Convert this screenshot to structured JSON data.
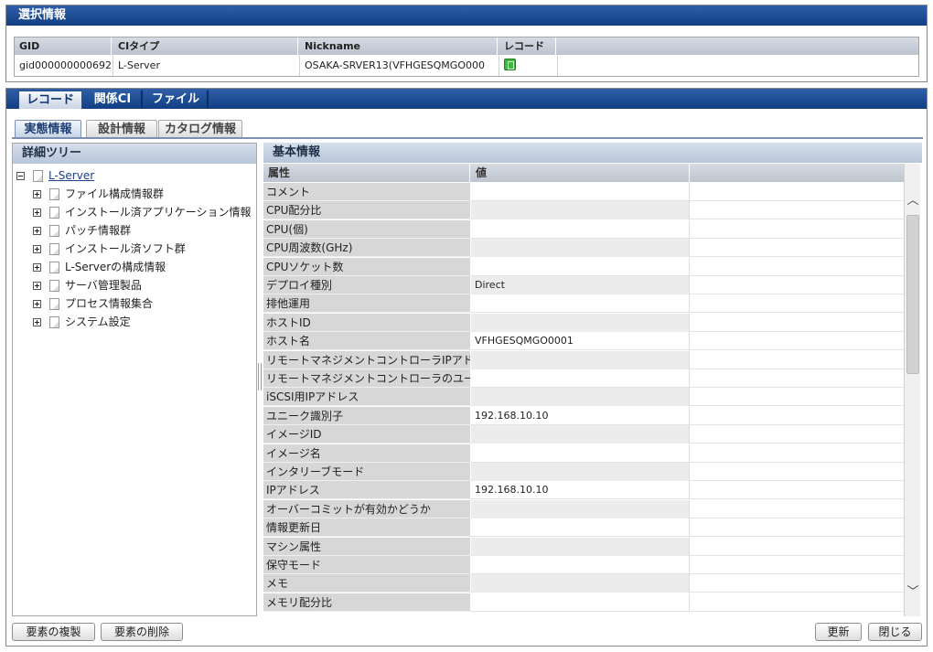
{
  "selection": {
    "title": "選択情報",
    "columns": [
      "GID",
      "CIタイプ",
      "Nickname",
      "レコード"
    ],
    "row": {
      "gid": "gid000000000692",
      "ci_type": "L-Server",
      "nickname": "OSAKA-SRVER13(VFHGESQMGO000",
      "record_icon": "green-record-icon"
    }
  },
  "main_tabs": [
    {
      "label": "レコード",
      "active": true
    },
    {
      "label": "関係CI",
      "active": false
    },
    {
      "label": "ファイル",
      "active": false
    }
  ],
  "sub_tabs": [
    {
      "label": "実態情報",
      "active": true
    },
    {
      "label": "設計情報",
      "active": false
    },
    {
      "label": "カタログ情報",
      "active": false
    }
  ],
  "tree": {
    "title": "詳細ツリー",
    "root": "L-Server",
    "children": [
      "ファイル構成情報群",
      "インストール済アプリケーション情報",
      "パッチ情報群",
      "インストール済ソフト群",
      "L-Serverの構成情報",
      "サーバ管理製品",
      "プロセス情報集合",
      "システム設定"
    ]
  },
  "detail": {
    "title": "基本情報",
    "columns": [
      "属性",
      "値"
    ],
    "rows": [
      {
        "key": "コメント",
        "value": ""
      },
      {
        "key": "CPU配分比",
        "value": ""
      },
      {
        "key": "CPU(個)",
        "value": ""
      },
      {
        "key": "CPU周波数(GHz)",
        "value": ""
      },
      {
        "key": "CPUソケット数",
        "value": ""
      },
      {
        "key": "デプロイ種別",
        "value": "Direct"
      },
      {
        "key": "排他運用",
        "value": ""
      },
      {
        "key": "ホストID",
        "value": ""
      },
      {
        "key": "ホスト名",
        "value": "VFHGESQMGO0001"
      },
      {
        "key": "リモートマネジメントコントローラIPアドレ",
        "value": ""
      },
      {
        "key": "リモートマネジメントコントローラのユーザ",
        "value": ""
      },
      {
        "key": "iSCSI用IPアドレス",
        "value": ""
      },
      {
        "key": "ユニーク識別子",
        "value": "192.168.10.10"
      },
      {
        "key": "イメージID",
        "value": ""
      },
      {
        "key": "イメージ名",
        "value": ""
      },
      {
        "key": "インタリーブモード",
        "value": ""
      },
      {
        "key": "IPアドレス",
        "value": "192.168.10.10"
      },
      {
        "key": "オーバーコミットが有効かどうか",
        "value": ""
      },
      {
        "key": "情報更新日",
        "value": ""
      },
      {
        "key": "マシン属性",
        "value": ""
      },
      {
        "key": "保守モード",
        "value": ""
      },
      {
        "key": "メモ",
        "value": ""
      },
      {
        "key": "メモリ配分比",
        "value": ""
      }
    ],
    "scroll": {
      "up_icon": "chevron-up-icon",
      "down_icon": "chevron-down-icon",
      "up_glyph": "︿",
      "down_glyph": "﹀"
    }
  },
  "buttons": {
    "duplicate": "要素の複製",
    "delete": "要素の削除",
    "refresh": "更新",
    "close": "閉じる"
  }
}
